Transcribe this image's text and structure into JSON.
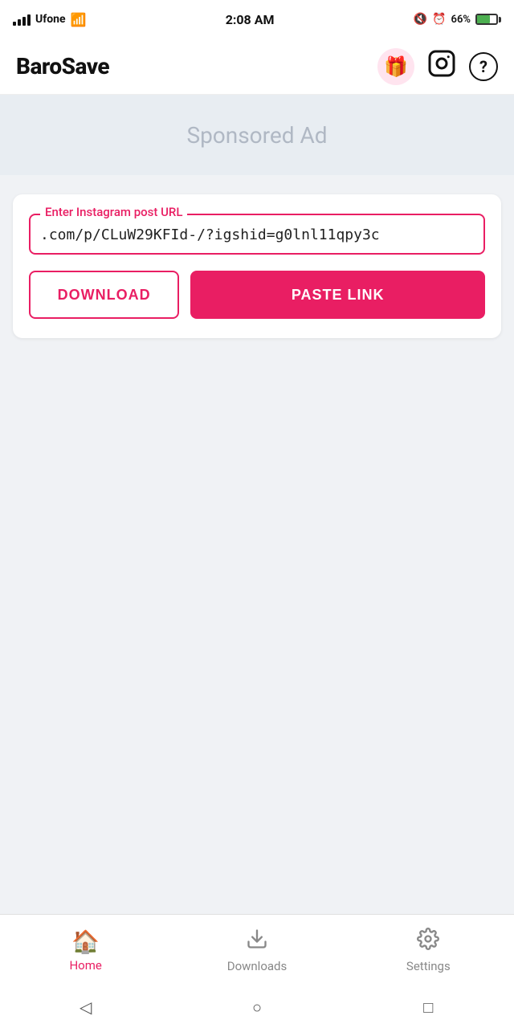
{
  "status_bar": {
    "carrier": "Ufone",
    "time": "2:08 AM",
    "battery_percent": "66%",
    "wifi": true
  },
  "header": {
    "logo": "BaroSave",
    "gift_icon_label": "gift",
    "instagram_icon_label": "instagram",
    "help_icon_label": "?"
  },
  "ad_banner": {
    "text": "Sponsored Ad"
  },
  "url_input": {
    "label": "Enter Instagram post URL",
    "value": ".com/p/CLuW29KFId-/?igshid=g0lnl11qpy3c",
    "placeholder": "Enter Instagram post URL"
  },
  "buttons": {
    "download_label": "DOWNLOAD",
    "paste_label": "PASTE LINK"
  },
  "bottom_nav": {
    "items": [
      {
        "id": "home",
        "label": "Home",
        "icon": "🏠",
        "active": true
      },
      {
        "id": "downloads",
        "label": "Downloads",
        "icon": "⬇",
        "active": false
      },
      {
        "id": "settings",
        "label": "Settings",
        "icon": "⚙",
        "active": false
      }
    ]
  },
  "android_nav": {
    "back_icon": "◁",
    "home_icon": "○",
    "recent_icon": "□"
  }
}
